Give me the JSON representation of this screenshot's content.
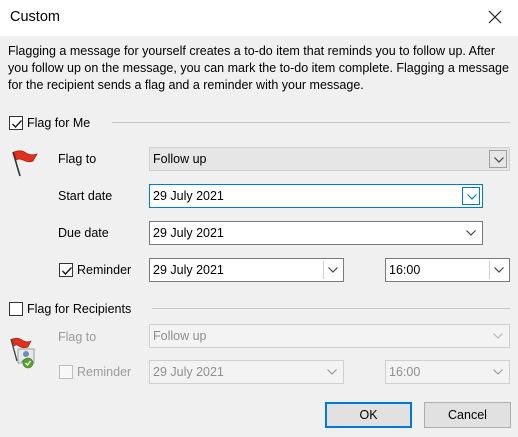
{
  "window": {
    "title": "Custom"
  },
  "intro_text": "Flagging a message for yourself creates a to-do item that reminds you to follow up. After you follow up on the message, you can mark the to-do item complete. Flagging a message for the recipient sends a flag and a reminder with your message.",
  "flag_for_me": {
    "label": "Flag for Me",
    "checked": true,
    "flag_to_label": "Flag to",
    "flag_to_value": "Follow up",
    "start_date_label": "Start date",
    "start_date_value": "29 July 2021",
    "due_date_label": "Due date",
    "due_date_value": "29 July 2021",
    "reminder_label": "Reminder",
    "reminder_checked": true,
    "reminder_date": "29 July 2021",
    "reminder_time": "16:00"
  },
  "flag_for_recipients": {
    "label": "Flag for Recipients",
    "checked": false,
    "flag_to_label": "Flag to",
    "flag_to_value": "Follow up",
    "reminder_label": "Reminder",
    "reminder_checked": false,
    "reminder_date": "29 July 2021",
    "reminder_time": "16:00"
  },
  "buttons": {
    "ok": "OK",
    "cancel": "Cancel"
  },
  "colors": {
    "accent": "#0078d7",
    "flag_red": "#e0301e",
    "disabled_text": "#9b9b9b"
  },
  "icons": [
    "close-icon",
    "red-flag-icon",
    "recipient-flag-icon",
    "chevron-down-icon",
    "checkmark-icon"
  ]
}
